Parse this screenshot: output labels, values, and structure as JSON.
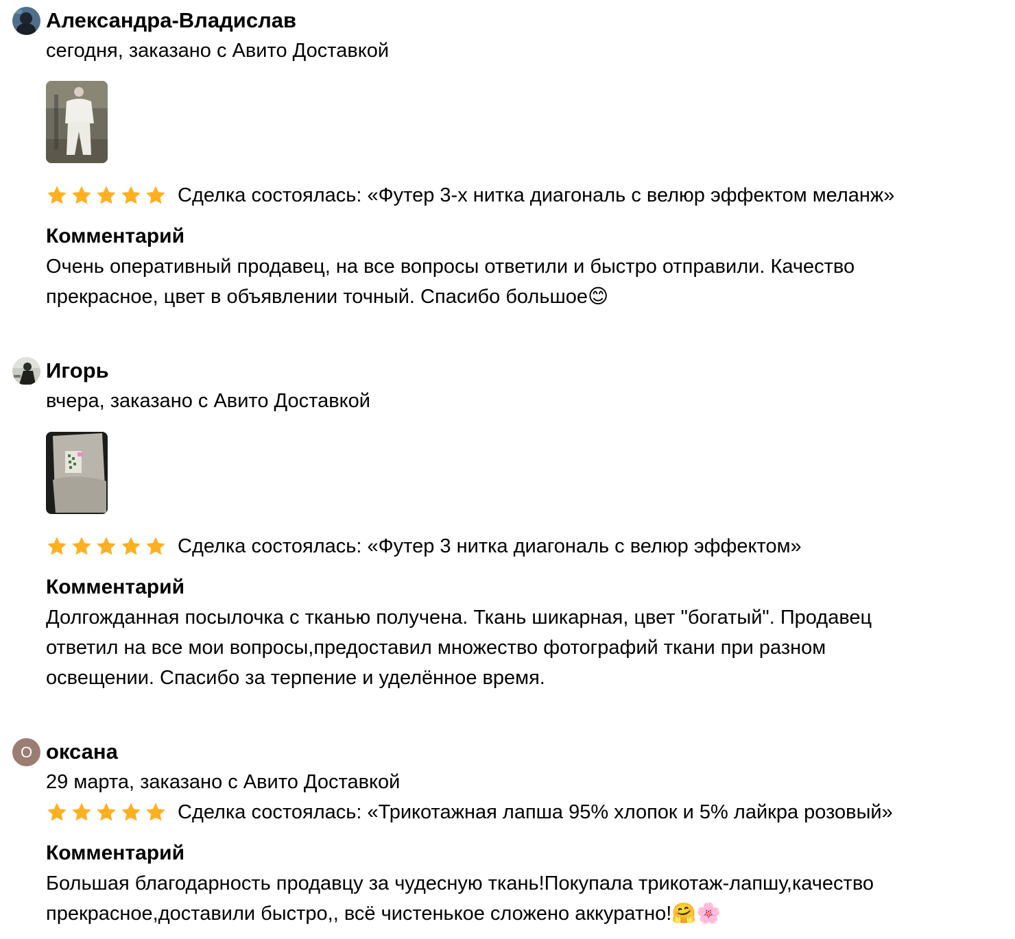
{
  "colors": {
    "star": "#FFB021",
    "text": "#000000",
    "avatar_letter_bg": "#9a7d73"
  },
  "reviews": [
    {
      "author": "Александра-Владислав",
      "meta": "сегодня, заказано с Авито Доставкой",
      "avatar_icon": "user-avatar-photo",
      "photo_icon": "review-photo",
      "rating": 5,
      "deal": "Сделка состоялась: «Футер 3-х нитка диагональ с велюр эффектом меланж»",
      "comment_title": "Комментарий",
      "comment_lines": [
        "Очень оперативный продавец, на все вопросы ответили и быстро отправили. Качество",
        "прекрасное, цвет в объявлении точный. Спасибо большое😊"
      ]
    },
    {
      "author": "Игорь",
      "meta": "вчера, заказано с Авито Доставкой",
      "avatar_icon": "user-avatar-photo",
      "photo_icon": "review-photo",
      "rating": 5,
      "deal": "Сделка состоялась: «Футер 3 нитка диагональ с велюр эффектом»",
      "comment_title": "Комментарий",
      "comment_lines": [
        "Долгожданная посылочка с тканью получена. Ткань шикарная, цвет \"богатый\". Продавец",
        "ответил на все мои вопросы,предоставил множество фотографий ткани при разном",
        "освещении. Спасибо за терпение и уделённое время."
      ]
    },
    {
      "author": "оксана",
      "meta": "29 марта, заказано с Авито Доставкой",
      "avatar_letter": "О",
      "rating": 5,
      "deal": "Сделка состоялась: «Трикотажная лапша 95% хлопок и 5% лайкра розовый»",
      "comment_title": "Комментарий",
      "comment_lines": [
        "Большая благодарность продавцу за чудесную ткань!Покупала трикотаж-лапшу,качество",
        "прекрасное,доставили быстро,, всё чистенькое сложено аккуратно!🤗🌸"
      ]
    }
  ]
}
